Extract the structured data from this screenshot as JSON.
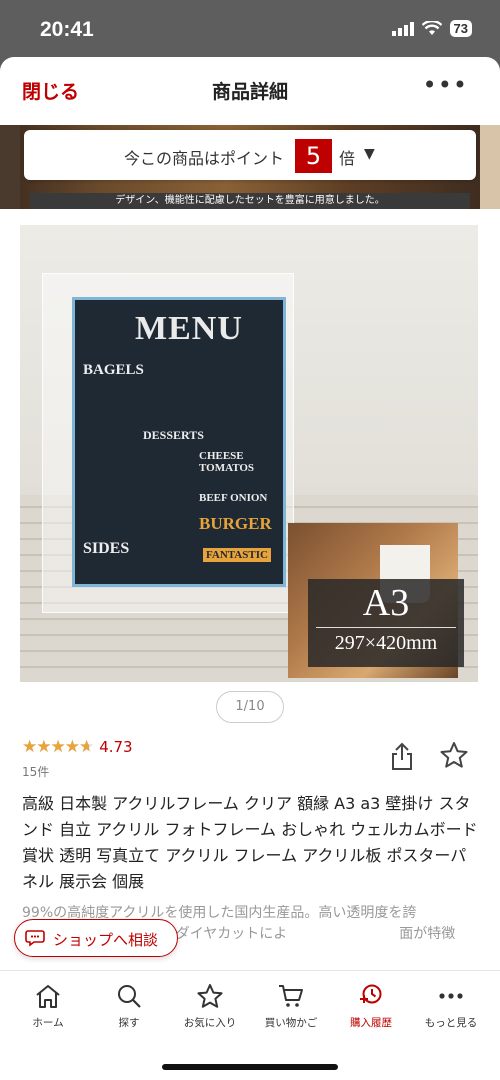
{
  "status_bar": {
    "time": "20:41",
    "battery": "73"
  },
  "nav": {
    "close_label": "閉じる",
    "title": "商品詳細",
    "more": "•••"
  },
  "banner": {
    "caption": "デザイン、機能性に配慮したセットを豊富に用意しました。"
  },
  "points": {
    "prefix": "今この商品はポイント",
    "multiplier": "5",
    "suffix": "倍",
    "caret": "▼"
  },
  "image": {
    "menu_title": "MENU",
    "menu_items": [
      "BAGELS",
      "DESSERTS",
      "SIDES",
      "CHEESE TOMATOS",
      "BEEF ONION",
      "BURGER",
      "FANTASTIC"
    ],
    "size_label": "A3",
    "size_dims": "297×420mm"
  },
  "pager": {
    "text": "1/10"
  },
  "rating": {
    "stars": "★★★★★",
    "value": "4.73",
    "reviews": "15件",
    "score_fraction": 0.946
  },
  "product": {
    "title": "高級 日本製 アクリルフレーム クリア 額縁 A3 a3 壁掛け スタンド 自立 アクリル フォトフレーム おしゃれ ウェルカムボード 賞状 透明 写真立て アクリル フレーム アクリル板 ポスターパネル 展示会 個展",
    "description": "99%の高純度アクリルを使用した国内生産品。高い透明度を誇　　　　　　　　黄変が殆どなく、側面はダイヤカットによ　　　　　　　　面が特徴"
  },
  "consult": {
    "label": "ショップへ相談"
  },
  "tabs": [
    {
      "label": "ホーム",
      "icon": "home-icon"
    },
    {
      "label": "探す",
      "icon": "search-icon"
    },
    {
      "label": "お気に入り",
      "icon": "star-icon"
    },
    {
      "label": "買い物かご",
      "icon": "cart-icon"
    },
    {
      "label": "購入履歴",
      "icon": "history-icon"
    },
    {
      "label": "もっと見る",
      "icon": "more-icon"
    }
  ],
  "colors": {
    "accent": "#bf0000",
    "star": "#e8a33a",
    "muted": "#999999"
  }
}
